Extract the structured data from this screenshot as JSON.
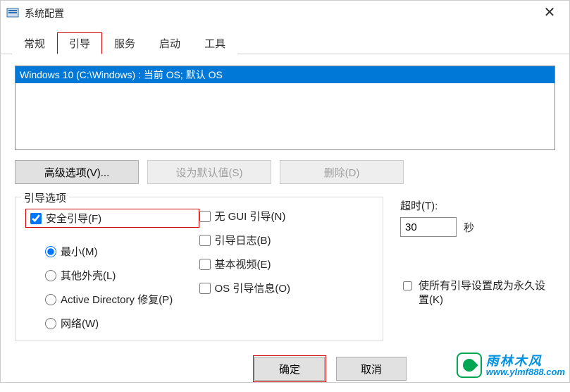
{
  "window": {
    "title": "系统配置"
  },
  "tabs": {
    "general": "常规",
    "boot": "引导",
    "services": "服务",
    "startup": "启动",
    "tools": "工具"
  },
  "boot_list": {
    "item0": "Windows 10 (C:\\Windows) : 当前 OS; 默认 OS"
  },
  "buttons": {
    "advanced": "高级选项(V)...",
    "set_default": "设为默认值(S)",
    "delete": "删除(D)",
    "ok": "确定",
    "cancel": "取消"
  },
  "boot_options": {
    "legend": "引导选项",
    "safe_boot": "安全引导(F)",
    "minimal": "最小(M)",
    "alt_shell": "其他外壳(L)",
    "ad_repair": "Active Directory 修复(P)",
    "network": "网络(W)",
    "no_gui": "无 GUI 引导(N)",
    "boot_log": "引导日志(B)",
    "base_video": "基本视频(E)",
    "os_info": "OS 引导信息(O)"
  },
  "timeout": {
    "label": "超时(T):",
    "value": "30",
    "unit": "秒"
  },
  "permanent": {
    "label": "使所有引导设置成为永久设置(K)"
  },
  "watermark": {
    "cn": "雨林木风",
    "url": "www.ylmf888.com"
  }
}
